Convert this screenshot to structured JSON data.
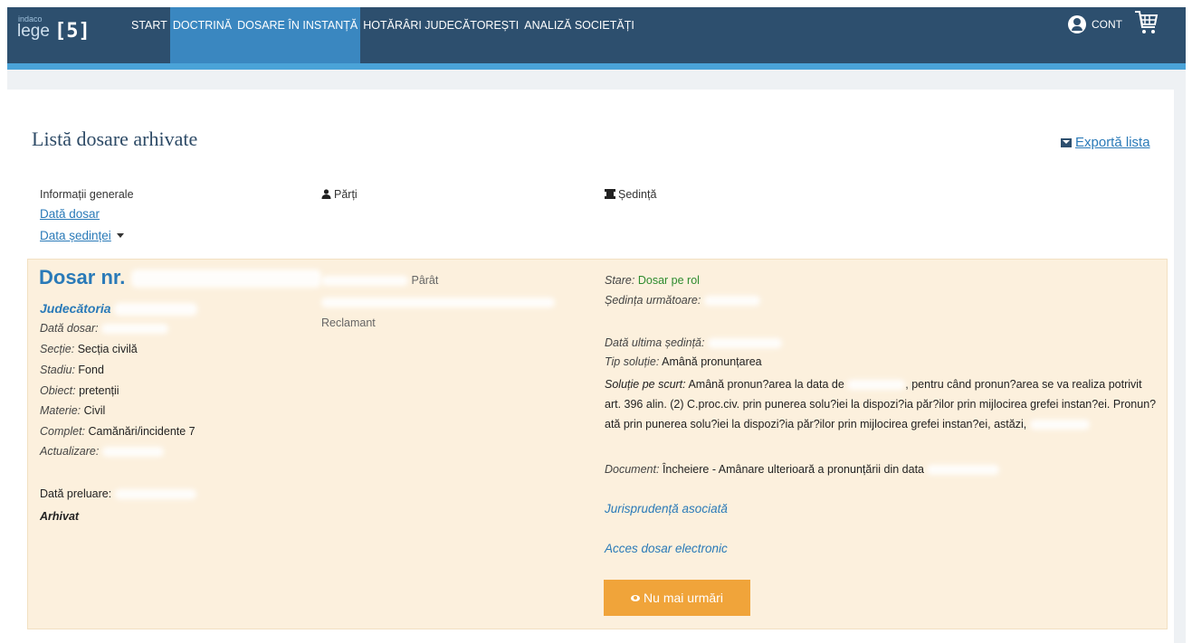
{
  "nav": {
    "logo_small": "indaco",
    "logo_word": "lege",
    "logo_num": "[5]",
    "items": [
      "START",
      "DOCTRINĂ",
      "DOSARE ÎN INSTANȚĂ",
      "HOTĂRÂRI JUDECĂTOREȘTI",
      "ANALIZĂ SOCIETĂȚI"
    ],
    "active_index": 2,
    "account_label": "CONT"
  },
  "page": {
    "title": "Listă dosare arhivate",
    "export_label": "Exportă lista"
  },
  "columns": {
    "general": "Informații generale",
    "sort_dosar": "Dată dosar",
    "sort_sedinta": "Data ședinței",
    "parti": "Părți",
    "sedinta": "Ședință"
  },
  "dosar": {
    "title_prefix": "Dosar nr.",
    "court_prefix": "Judecătoria",
    "data_dosar_label": "Dată dosar:",
    "sectie_label": "Secție:",
    "sectie_value": "Secția civilă",
    "stadiu_label": "Stadiu:",
    "stadiu_value": "Fond",
    "obiect_label": "Obiect:",
    "obiect_value": "pretenții",
    "materie_label": "Materie:",
    "materie_value": "Civil",
    "complet_label": "Complet:",
    "complet_value": "Camănări/incidente 7",
    "actualizare_label": "Actualizare:",
    "preluare_label": "Dată preluare:",
    "status": "Arhivat",
    "parat": "Pârât",
    "reclamant": "Reclamant",
    "stare_label": "Stare:",
    "stare_value": "Dosar pe rol",
    "urmatoare_label": "Ședința următoare:",
    "ultima_label": "Dată ultima ședință:",
    "tip_label": "Tip soluție:",
    "tip_value": "Amână pronunțarea",
    "solutie_label": "Soluție pe scurt:",
    "solutie_part1": "Amână pronun?area la data de",
    "solutie_part2": ", pentru când pronun?area se va realiza potrivit art. 396 alin. (2) C.proc.civ. prin punerea solu?iei la dispozi?ia păr?ilor prin mijlocirea grefei instan?ei. Pronun?ată prin punerea solu?iei la dispozi?ia păr?ilor prin mijlocirea grefei instan?ei, astăzi,",
    "document_label": "Document:",
    "document_value": "Încheiere - Amânare ulterioară a pronunțării din data",
    "jurisprudenta": "Jurisprudență asociată",
    "acces": "Acces dosar electronic",
    "button": "Nu mai urmări"
  }
}
